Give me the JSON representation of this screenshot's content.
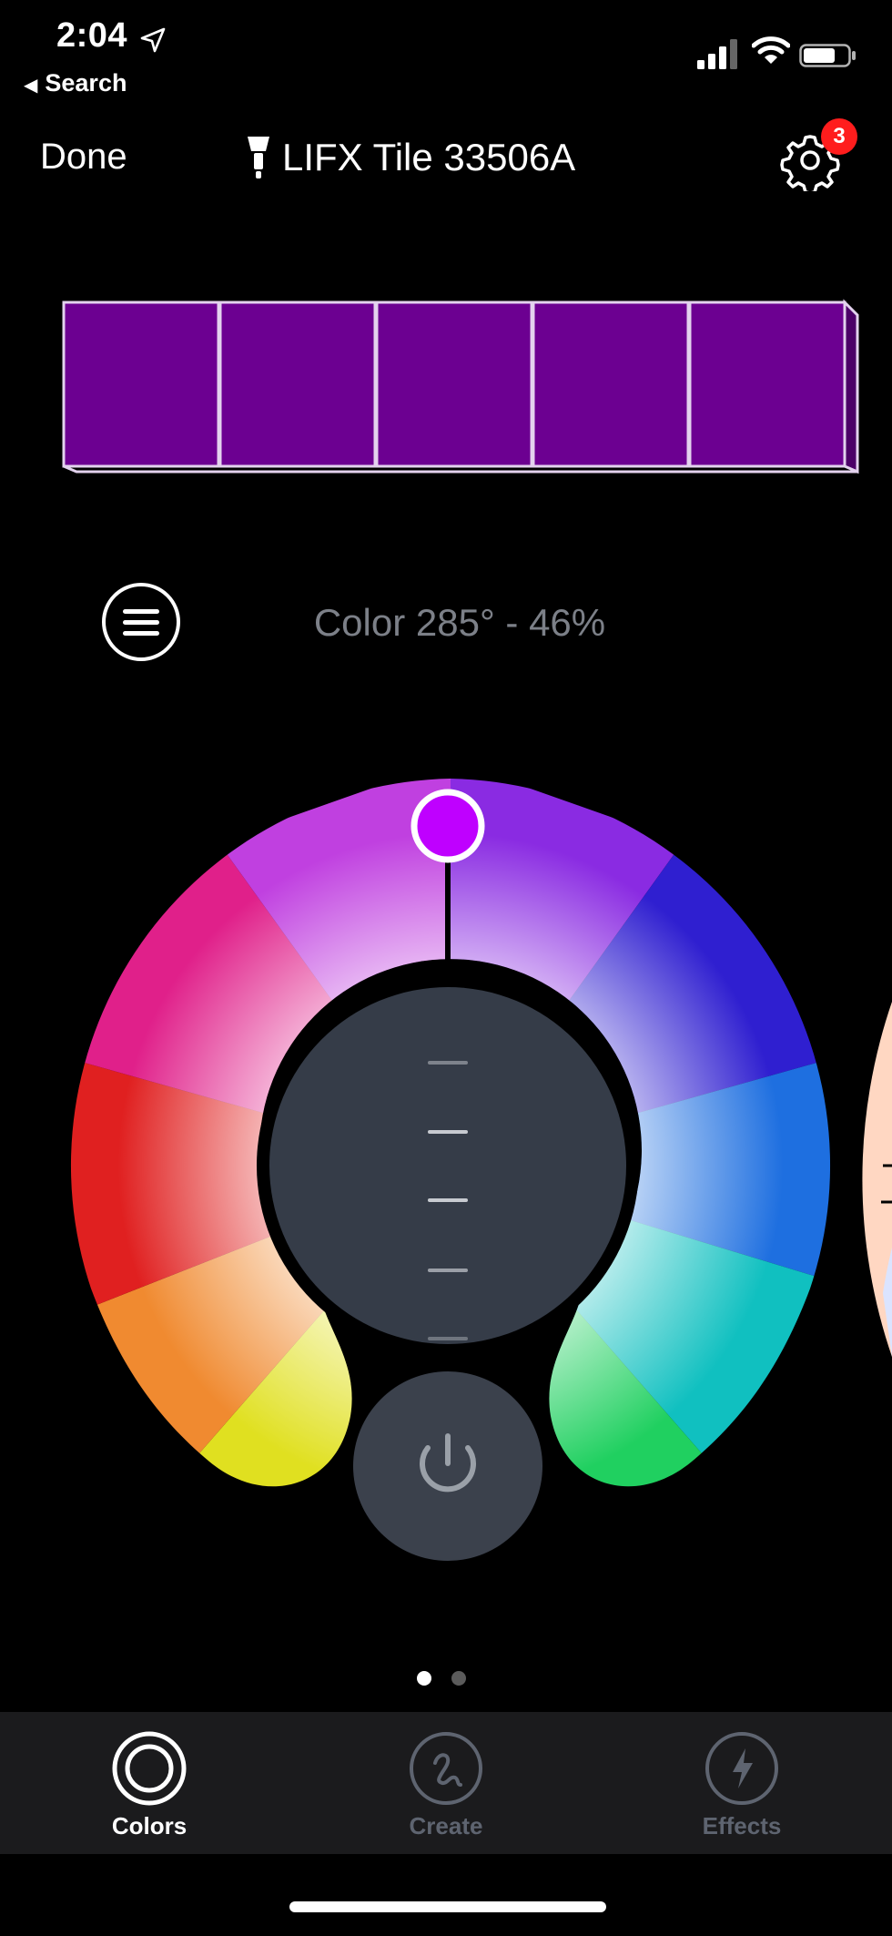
{
  "status_bar": {
    "time": "2:04",
    "back_label": "Search"
  },
  "nav": {
    "done_label": "Done",
    "title": "LIFX Tile 33506A",
    "settings_badge": "3"
  },
  "tiles": {
    "count": 5,
    "color": "#6c0091"
  },
  "color_label": "Color 285° - 46%",
  "wheel": {
    "hue_deg": 285,
    "saturation_pct": 46,
    "selected_color": "#bf00ff"
  },
  "pager": {
    "pages": 2,
    "active": 0
  },
  "tabs": [
    {
      "label": "Colors",
      "icon": "colors-icon",
      "active": true
    },
    {
      "label": "Create",
      "icon": "create-icon",
      "active": false
    },
    {
      "label": "Effects",
      "icon": "effects-icon",
      "active": false
    }
  ],
  "colors": {
    "background": "#000000",
    "tabbar": "#1b1b1d",
    "inactive_tab": "#5e6470",
    "badge": "#ff1d1d"
  }
}
